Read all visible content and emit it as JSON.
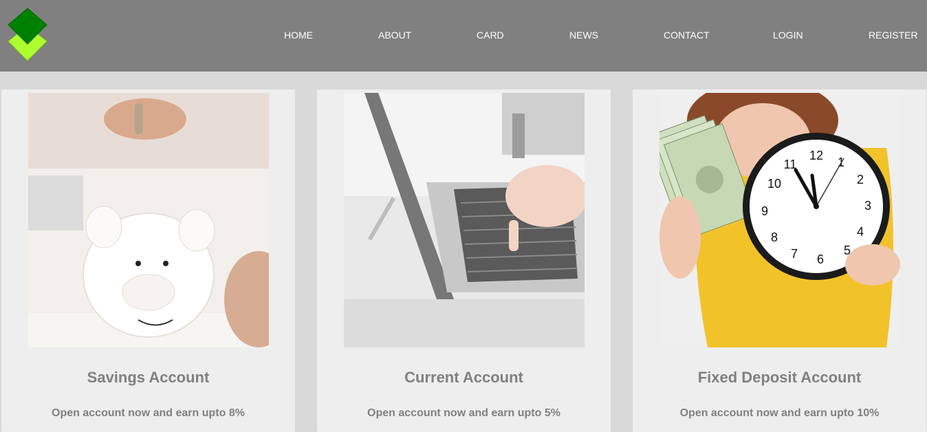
{
  "brand": {
    "logo_icon": "green-diamonds-logo-icon",
    "colors": {
      "dark": "#008000",
      "light": "#adff2f"
    }
  },
  "nav": {
    "items": [
      {
        "label": "HOME"
      },
      {
        "label": "ABOUT"
      },
      {
        "label": "CARD"
      },
      {
        "label": "NEWS"
      },
      {
        "label": "CONTACT"
      },
      {
        "label": "LOGIN"
      },
      {
        "label": "REGISTER"
      }
    ]
  },
  "cards": [
    {
      "title": "Savings Account",
      "description": "Open account now and earn upto 8%",
      "image_icon": "piggy-bank-photo"
    },
    {
      "title": "Current Account",
      "description": "Open account now and earn upto 5%",
      "image_icon": "laptop-typing-photo"
    },
    {
      "title": "Fixed Deposit Account",
      "description": "Open account now and earn upto 10%",
      "image_icon": "clock-money-photo"
    }
  ],
  "colors": {
    "header_bg": "#808080",
    "page_bg": "#d9d9d9",
    "card_bg": "#eeeeee",
    "text_gray": "#808080"
  }
}
